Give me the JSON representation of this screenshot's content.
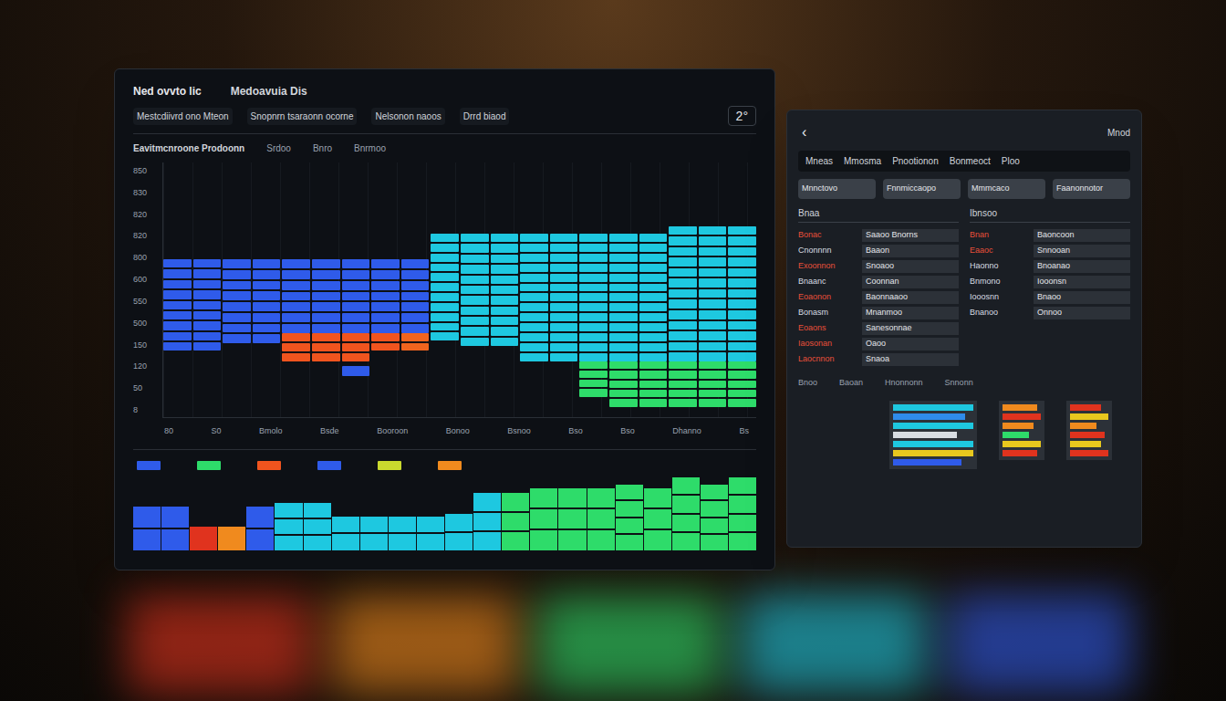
{
  "main": {
    "title": "Ned ovvto lic",
    "subtitle": "Medoavuia Dis",
    "toolbar": [
      "Mestcdiivrd ono Mteon",
      "Snopnrn tsaraonn ocorne",
      "Nelsonon naoos",
      "Drrd biaod"
    ],
    "count": "2°",
    "chart": {
      "title": "Eavitmcnroone Prodoonn",
      "labels": [
        "Srdoo",
        "Bnro",
        "Bnrmoo"
      ],
      "y_ticks": [
        "850",
        "830",
        "820",
        "820",
        "800",
        "600",
        "550",
        "500",
        "150",
        "120",
        "50",
        "8"
      ],
      "x_ticks": [
        "80",
        "S0",
        "Bmolo",
        "Bsde",
        "Booroon",
        "Bonoo",
        "Bsnoo",
        "Bso",
        "Bso",
        "Dhanno",
        "Bs"
      ],
      "columns": [
        {
          "segments": [
            {
              "color": "#2f5bea",
              "low": 26,
              "high": 62
            }
          ]
        },
        {
          "segments": [
            {
              "color": "#2f5bea",
              "low": 26,
              "high": 62
            }
          ]
        },
        {
          "segments": [
            {
              "color": "#2f5bea",
              "low": 29,
              "high": 62
            }
          ]
        },
        {
          "segments": [
            {
              "color": "#2f5bea",
              "low": 29,
              "high": 62
            }
          ]
        },
        {
          "segments": [
            {
              "color": "#2f5bea",
              "low": 33,
              "high": 62
            },
            {
              "color": "#f0541e",
              "low": 22,
              "high": 33
            }
          ]
        },
        {
          "segments": [
            {
              "color": "#2f5bea",
              "low": 33,
              "high": 62
            },
            {
              "color": "#f0541e",
              "low": 22,
              "high": 33
            }
          ]
        },
        {
          "segments": [
            {
              "color": "#2f5bea",
              "low": 33,
              "high": 62
            },
            {
              "color": "#f0541e",
              "low": 22,
              "high": 33
            },
            {
              "color": "#2f5bea",
              "low": 16,
              "high": 20
            }
          ]
        },
        {
          "segments": [
            {
              "color": "#2f5bea",
              "low": 33,
              "high": 62
            },
            {
              "color": "#f0541e",
              "low": 26,
              "high": 33
            }
          ]
        },
        {
          "segments": [
            {
              "color": "#2f5bea",
              "low": 33,
              "high": 62
            },
            {
              "color": "#f0641e",
              "low": 26,
              "high": 33
            }
          ]
        },
        {
          "segments": [
            {
              "color": "#1ec8e0",
              "low": 30,
              "high": 72
            }
          ]
        },
        {
          "segments": [
            {
              "color": "#1ec8e0",
              "low": 28,
              "high": 72
            }
          ]
        },
        {
          "segments": [
            {
              "color": "#1ec8e0",
              "low": 28,
              "high": 72
            }
          ]
        },
        {
          "segments": [
            {
              "color": "#1ec8e0",
              "low": 22,
              "high": 72
            }
          ]
        },
        {
          "segments": [
            {
              "color": "#1ec8e0",
              "low": 22,
              "high": 72
            }
          ]
        },
        {
          "segments": [
            {
              "color": "#1ec8e0",
              "low": 22,
              "high": 72
            },
            {
              "color": "#2edc6a",
              "low": 8,
              "high": 22
            }
          ]
        },
        {
          "segments": [
            {
              "color": "#1ec8e0",
              "low": 22,
              "high": 72
            },
            {
              "color": "#2edc6a",
              "low": 4,
              "high": 22
            }
          ]
        },
        {
          "segments": [
            {
              "color": "#1ec8e0",
              "low": 22,
              "high": 72
            },
            {
              "color": "#2edc6a",
              "low": 4,
              "high": 22
            }
          ]
        },
        {
          "segments": [
            {
              "color": "#1ec8e0",
              "low": 22,
              "high": 75
            },
            {
              "color": "#2edc6a",
              "low": 4,
              "high": 22
            }
          ]
        },
        {
          "segments": [
            {
              "color": "#1ec8e0",
              "low": 22,
              "high": 75
            },
            {
              "color": "#2edc6a",
              "low": 4,
              "high": 22
            }
          ]
        },
        {
          "segments": [
            {
              "color": "#1ec8e0",
              "low": 22,
              "high": 75
            },
            {
              "color": "#2edc6a",
              "low": 4,
              "high": 22
            }
          ]
        }
      ]
    },
    "legend": [
      {
        "color": "#2f5bea"
      },
      {
        "color": "#2edc6a"
      },
      {
        "color": "#f0541e"
      },
      {
        "color": "#2f5bea"
      },
      {
        "color": "#c9d92e"
      },
      {
        "color": "#f08a1e"
      }
    ],
    "strip": [
      {
        "color": "#2f5bea",
        "value": 60
      },
      {
        "color": "#2f5bea",
        "value": 60
      },
      {
        "color": "#e0331e",
        "value": 32
      },
      {
        "color": "#f08a1e",
        "value": 32
      },
      {
        "color": "#2f5bea",
        "value": 60
      },
      {
        "color": "#1ec8e0",
        "value": 64
      },
      {
        "color": "#1ec8e0",
        "value": 64
      },
      {
        "color": "#1ec8e0",
        "value": 46
      },
      {
        "color": "#1ec8e0",
        "value": 46
      },
      {
        "color": "#1ec8e0",
        "value": 46
      },
      {
        "color": "#1ec8e0",
        "value": 46
      },
      {
        "color": "#1ec8e0",
        "value": 50
      },
      {
        "color": "#1ec8e0",
        "value": 78
      },
      {
        "color": "#2edc6a",
        "value": 78
      },
      {
        "color": "#2edc6a",
        "value": 84
      },
      {
        "color": "#2edc6a",
        "value": 84
      },
      {
        "color": "#2edc6a",
        "value": 84
      },
      {
        "color": "#2edc6a",
        "value": 90
      },
      {
        "color": "#2edc6a",
        "value": 84
      },
      {
        "color": "#2edc6a",
        "value": 100
      },
      {
        "color": "#2edc6a",
        "value": 90
      },
      {
        "color": "#2edc6a",
        "value": 100
      }
    ]
  },
  "side": {
    "back": "‹",
    "title": "Mnod",
    "header": [
      "Mneas",
      "Mmosma",
      "Pnootionon",
      "Bonmeoct",
      "Ploo"
    ],
    "filters": [
      "Mnnctovo",
      "Fnnmiccaopo",
      "Mmmcaco",
      "Faanonnotor"
    ],
    "sections": [
      "Bnaa",
      "Ibnsoo"
    ],
    "lists": [
      [
        {
          "label": "Bonac",
          "detail": "Saaoo Bnorns",
          "color": "#e8503a"
        },
        {
          "label": "Cnonnnn",
          "detail": "Baaon",
          "color": "#d8dde3"
        },
        {
          "label": "Exoonnon",
          "detail": "Snoaoo",
          "color": "#e8503a"
        },
        {
          "label": "Bnaanc",
          "detail": "Coonnan",
          "color": "#d8dde3"
        },
        {
          "label": "Eoaonon",
          "detail": "Baonnaaoo",
          "color": "#e8503a"
        },
        {
          "label": "Bonasm",
          "detail": "Mnanmoo",
          "color": "#d8dde3"
        },
        {
          "label": "Eoaons",
          "detail": "Sanesonnae",
          "color": "#e8503a"
        },
        {
          "label": "Iaosonan",
          "detail": "Oaoo",
          "color": "#e8503a"
        },
        {
          "label": "Laocnnon",
          "detail": "Snaoa",
          "color": "#e8503a"
        }
      ],
      [
        {
          "label": "Bnan",
          "detail": "Baoncoon",
          "color": "#e8503a"
        },
        {
          "label": "Eaaoc",
          "detail": "Snnooan",
          "color": "#e8503a"
        },
        {
          "label": "Haonno",
          "detail": "Bnoanao",
          "color": "#d8dde3"
        },
        {
          "label": "Bnmono",
          "detail": "Iooonsn",
          "color": "#d8dde3"
        },
        {
          "label": "Iooosnn",
          "detail": "Bnaoo",
          "color": "#d8dde3"
        },
        {
          "label": "Bnanoo",
          "detail": "Onnoo",
          "color": "#d8dde3"
        }
      ]
    ],
    "notes": [
      "Bnoo",
      "Baoan",
      "Hnonnonn",
      "Snnonn"
    ],
    "mini_charts": [
      [
        {
          "color": "#1ec8e0",
          "level": 1
        },
        {
          "color": "#2f8bea",
          "level": 0.9
        },
        {
          "color": "#1ec8e0",
          "level": 1
        },
        {
          "color": "#d8dde3",
          "level": 0.8
        },
        {
          "color": "#1ec8e0",
          "level": 1
        },
        {
          "color": "#e8c81e",
          "level": 1
        },
        {
          "color": "#2f5bea",
          "level": 0.85
        }
      ],
      [
        {
          "color": "#f08a1e",
          "level": 0.9
        },
        {
          "color": "#e0331e",
          "level": 1
        },
        {
          "color": "#f08a1e",
          "level": 0.8
        },
        {
          "color": "#2edc6a",
          "level": 0.7
        },
        {
          "color": "#e8c81e",
          "level": 1
        },
        {
          "color": "#e0331e",
          "level": 0.9
        }
      ],
      [
        {
          "color": "#e0331e",
          "level": 0.8
        },
        {
          "color": "#e8c81e",
          "level": 1
        },
        {
          "color": "#f08a1e",
          "level": 0.7
        },
        {
          "color": "#e0331e",
          "level": 0.9
        },
        {
          "color": "#e8c81e",
          "level": 0.8
        },
        {
          "color": "#e0331e",
          "level": 1
        }
      ]
    ]
  }
}
